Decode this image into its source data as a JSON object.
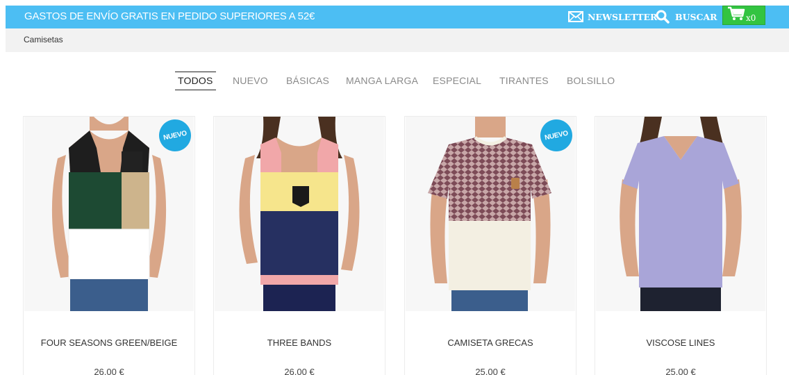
{
  "topbar": {
    "promo": "GASTOS DE ENVÍO GRATIS EN PEDIDO SUPERIORES A 52€",
    "newsletter_label": "NEWSLETTER",
    "search_label": "BUSCAR",
    "cart_count": "x0",
    "colors": {
      "bar": "#4cbef3",
      "cart": "#33c441"
    }
  },
  "breadcrumb": {
    "current": "Camisetas"
  },
  "filters": [
    {
      "label": "TODOS",
      "active": true
    },
    {
      "label": "NUEVO"
    },
    {
      "label": "BÁSICAS"
    },
    {
      "label": "MANGA LARGA"
    },
    {
      "label": "ESPECIAL"
    },
    {
      "label": "TIRANTES"
    },
    {
      "label": "BOLSILLO"
    }
  ],
  "products": [
    {
      "name": "FOUR SEASONS GREEN/BEIGE",
      "price": "26.00 €",
      "badge": "NUEVO"
    },
    {
      "name": "THREE BANDS",
      "price": "26.00 €"
    },
    {
      "name": "CAMISETA GRECAS",
      "price": "25.00 €",
      "badge": "NUEVO"
    },
    {
      "name": "VISCOSE LINES",
      "price": "25.00 €"
    }
  ],
  "product_images": [
    {
      "shirt": "tank-top",
      "colors": [
        "#1e1e1e",
        "#1d4a33",
        "#cdb48c",
        "#ffffff"
      ]
    },
    {
      "shirt": "tank-top",
      "colors": [
        "#1c2352",
        "#f6e58c",
        "#f1a7a9",
        "#263061"
      ]
    },
    {
      "shirt": "t-shirt",
      "colors": [
        "#7d4b57",
        "#f3efe2"
      ]
    },
    {
      "shirt": "v-neck",
      "colors": [
        "#a9a5d8"
      ]
    }
  ]
}
